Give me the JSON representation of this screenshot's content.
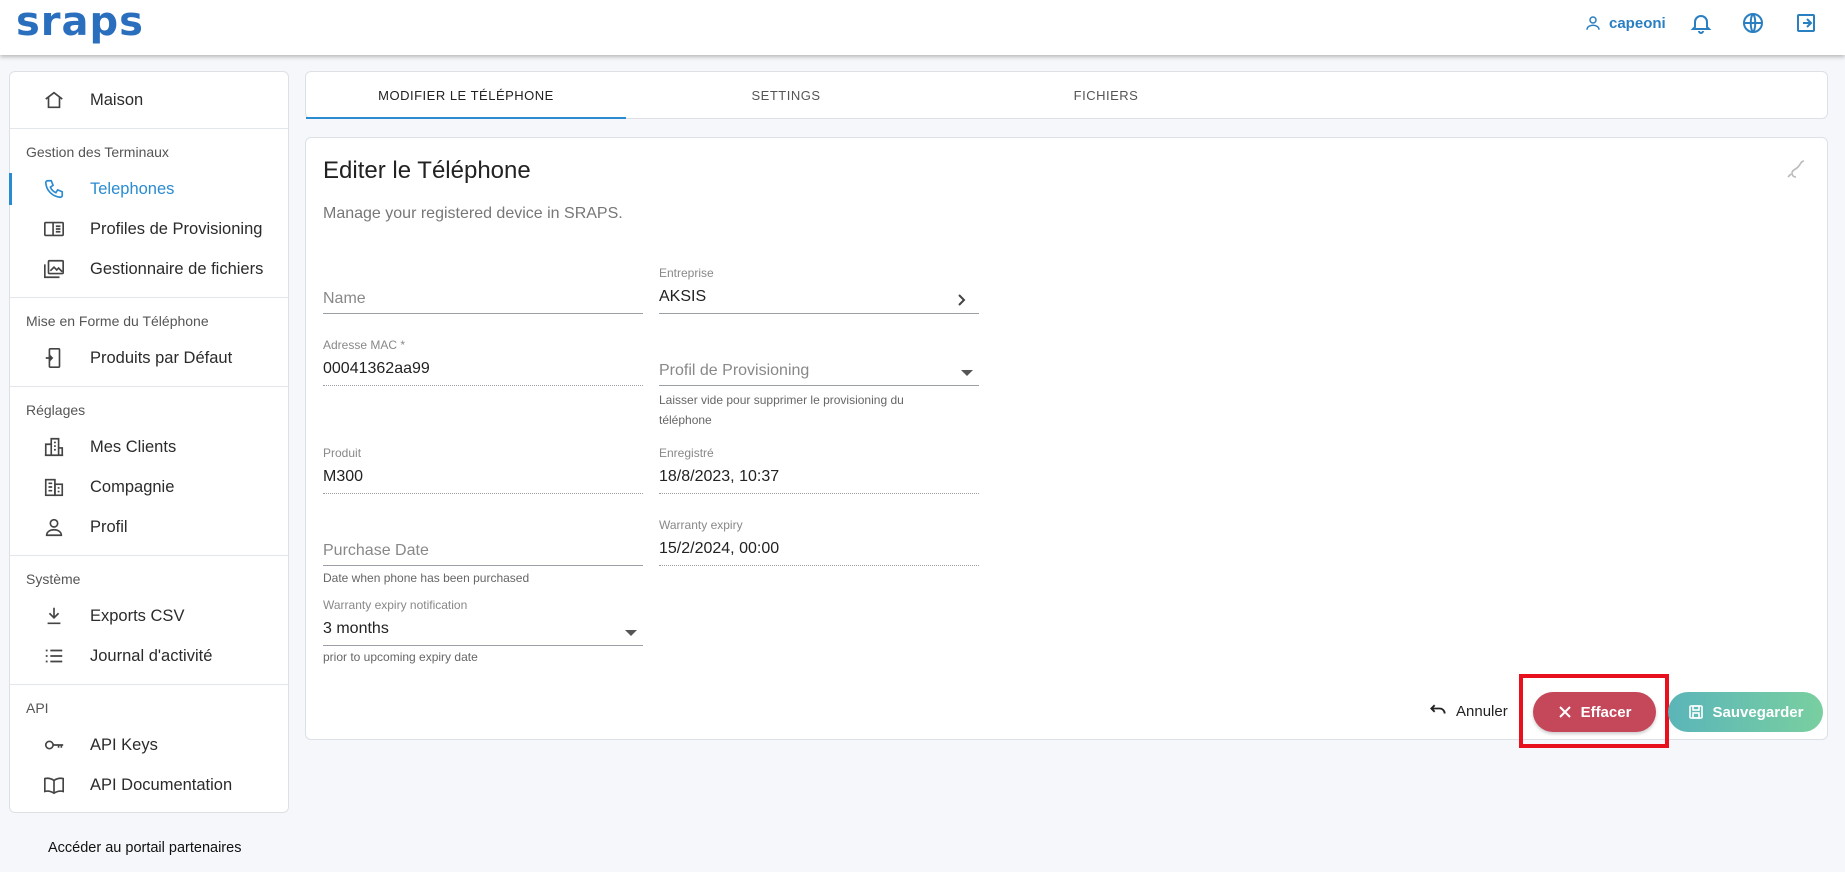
{
  "header": {
    "logo": "sraps",
    "username": "capeoni",
    "icons": [
      "user-icon",
      "bell-icon",
      "globe-icon",
      "logout-icon"
    ]
  },
  "sidebar": {
    "home": "Maison",
    "sections": [
      {
        "title": "Gestion des Terminaux",
        "items": [
          "Telephones",
          "Profiles de Provisioning",
          "Gestionnaire de fichiers"
        ]
      },
      {
        "title": "Mise en Forme du Téléphone",
        "items": [
          "Produits par Défaut"
        ]
      },
      {
        "title": "Réglages",
        "items": [
          "Mes Clients",
          "Compagnie",
          "Profil"
        ]
      },
      {
        "title": "Système",
        "items": [
          "Exports CSV",
          "Journal d'activité"
        ]
      },
      {
        "title": "API",
        "items": [
          "API Keys",
          "API Documentation"
        ]
      }
    ],
    "active_item": "Telephones",
    "partner_link": "Accéder au portail partenaires"
  },
  "tabs": [
    {
      "label": "MODIFIER LE TÉLÉPHONE",
      "active": true
    },
    {
      "label": "SETTINGS",
      "active": false
    },
    {
      "label": "FICHIERS",
      "active": false
    }
  ],
  "card": {
    "title": "Editer le Téléphone",
    "subtitle": "Manage your registered device in SRAPS."
  },
  "form": {
    "name": {
      "placeholder": "Name",
      "value": ""
    },
    "entreprise": {
      "label": "Entreprise",
      "value": "AKSIS"
    },
    "mac": {
      "label": "Adresse MAC *",
      "value": "00041362aa99"
    },
    "provisioning": {
      "placeholder": "Profil de Provisioning",
      "hint": "Laisser vide pour supprimer le provisioning du téléphone"
    },
    "produit": {
      "label": "Produit",
      "value": "M300"
    },
    "enregistre": {
      "label": "Enregistré",
      "value": "18/8/2023, 10:37"
    },
    "purchase_date": {
      "placeholder": "Purchase Date",
      "hint": "Date when phone has been purchased"
    },
    "warranty_expiry": {
      "label": "Warranty expiry",
      "value": "15/2/2024, 00:00"
    },
    "warranty_notification": {
      "label": "Warranty expiry notification",
      "value": "3 months",
      "hint": "prior to upcoming expiry date"
    }
  },
  "actions": {
    "cancel": "Annuler",
    "delete": "Effacer",
    "save": "Sauvegarder"
  },
  "colors": {
    "accent": "#2a8bd0",
    "delete": "#c4475a",
    "save_from": "#5bb5b9",
    "save_to": "#79cfa0",
    "highlight": "#e8101c"
  }
}
